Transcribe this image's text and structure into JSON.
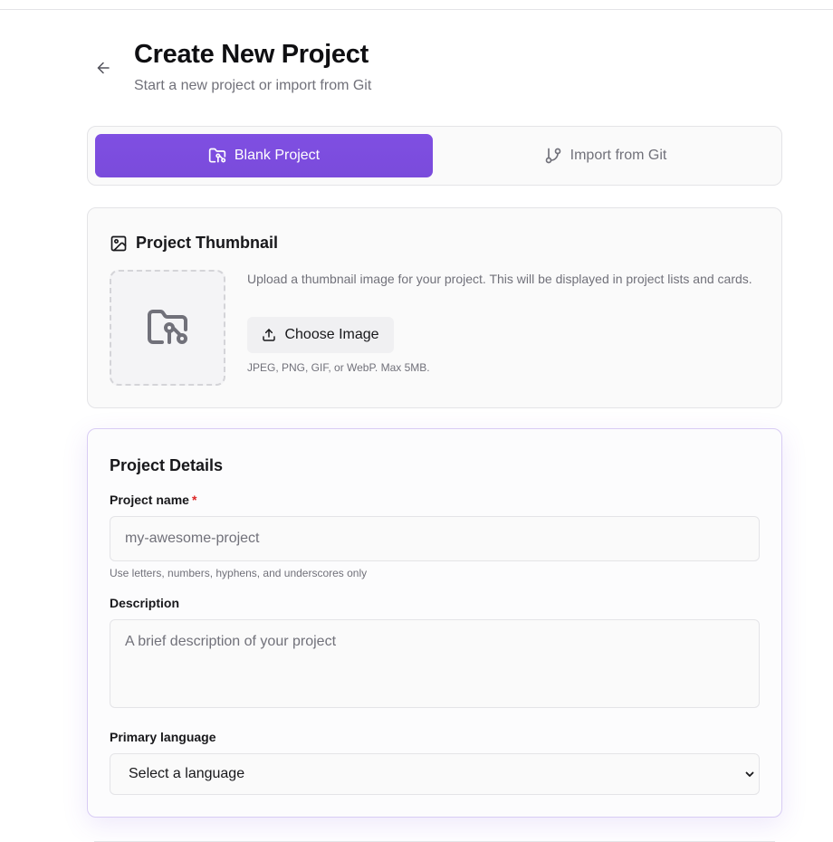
{
  "header": {
    "title": "Create New Project",
    "subtitle": "Start a new project or import from Git"
  },
  "mode_tabs": [
    {
      "label": "Blank Project",
      "icon": "folder-git-icon",
      "active": true
    },
    {
      "label": "Import from Git",
      "icon": "git-branch-icon",
      "active": false
    }
  ],
  "thumbnail": {
    "title": "Project Thumbnail",
    "description": "Upload a thumbnail image for your project. This will be displayed in project lists and cards.",
    "button_label": "Choose Image",
    "hint": "JPEG, PNG, GIF, or WebP. Max 5MB."
  },
  "details": {
    "title": "Project Details",
    "name_label": "Project name",
    "name_required_mark": "*",
    "name_placeholder": "my-awesome-project",
    "name_hint": "Use letters, numbers, hyphens, and underscores only",
    "description_label": "Description",
    "description_placeholder": "A brief description of your project",
    "language_label": "Primary language",
    "language_value": "Select a language"
  },
  "colors": {
    "accent": "#7c4ddf",
    "required": "#dc2626",
    "muted_text": "#71717a",
    "border": "#e4e4e7"
  }
}
